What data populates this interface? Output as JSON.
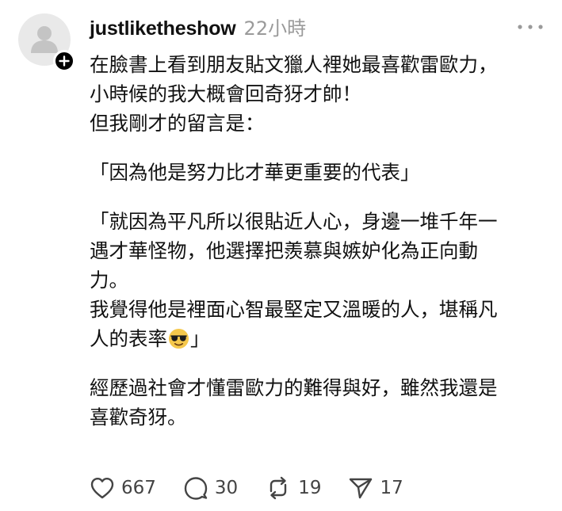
{
  "post": {
    "author": {
      "username": "justliketheshow",
      "avatar_icon": "default-avatar-icon",
      "follow_icon": "plus-icon"
    },
    "time": "22小時",
    "more_icon": "more-horizontal-icon",
    "content": {
      "p1_line1": "在臉書上看到朋友貼文獵人裡她最喜歡雷歐力，",
      "p1_line2": "小時候的我大概會回奇犽才帥！",
      "p1_line3": "但我剛才的留言是：",
      "p2": "「因為他是努力比才華更重要的代表」",
      "p3_line1": "「就因為平凡所以很貼近人心，身邊一堆千年一",
      "p3_line2": "遇才華怪物，他選擇把羨慕與嫉妒化為正向動",
      "p3_line3": "力。",
      "p3_line4": "我覺得他是裡面心智最堅定又溫暖的人，堪稱凡",
      "p3_line5_before": "人的表率",
      "p3_line5_emoji": "smiling-face-with-sunglasses",
      "p3_line5_after": "」",
      "p4_line1": "經歷過社會才懂雷歐力的難得與好，雖然我還是",
      "p4_line2": "喜歡奇犽。"
    },
    "actions": {
      "like": {
        "icon": "heart-icon",
        "count": "667"
      },
      "reply": {
        "icon": "comment-icon",
        "count": "30"
      },
      "repost": {
        "icon": "repost-icon",
        "count": "19"
      },
      "share": {
        "icon": "send-icon",
        "count": "17"
      }
    }
  },
  "colors": {
    "text": "#111111",
    "muted": "#9a9a9a",
    "icon": "#444444",
    "avatar_bg": "#e9e9e9",
    "avatar_fg": "#c4c4c4",
    "emoji_yellow": "#f5c84c"
  }
}
